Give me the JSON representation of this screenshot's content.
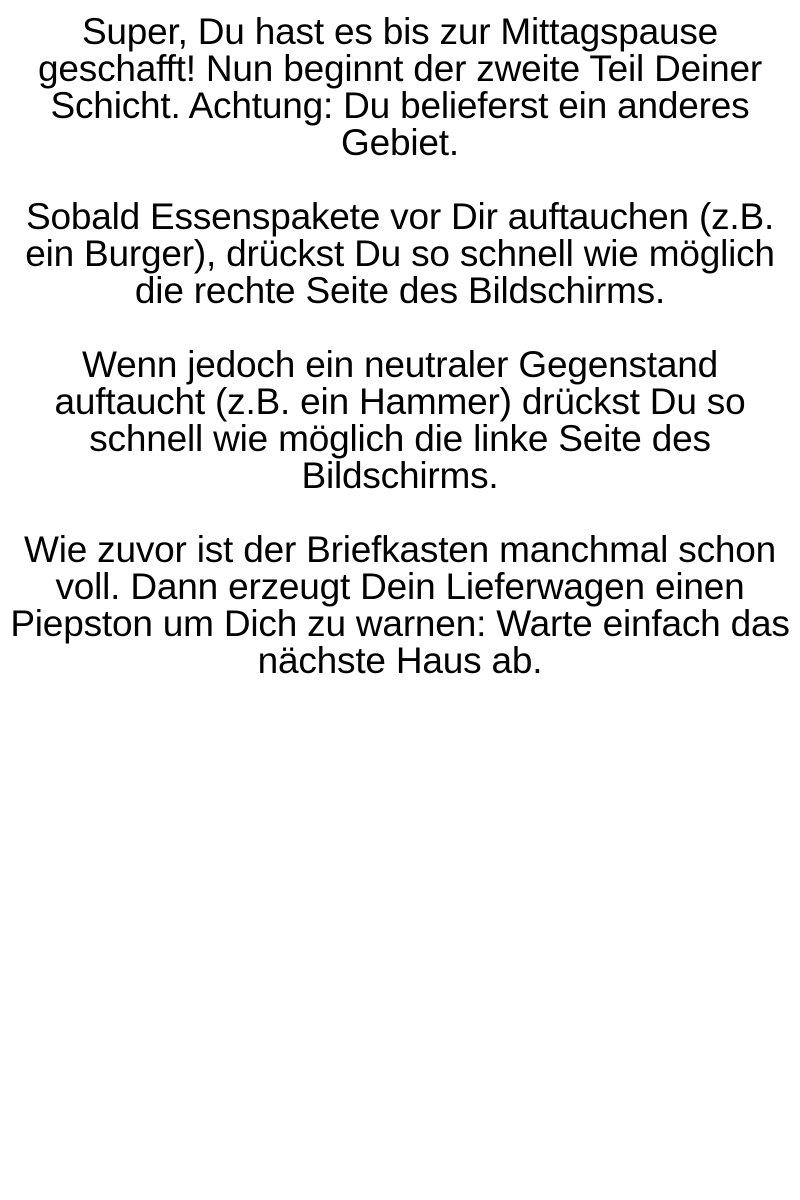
{
  "instructions": {
    "paragraphs": [
      "Super, Du hast es bis zur Mittagspause geschafft! Nun beginnt der zweite Teil Deiner Schicht. Achtung: Du belieferst ein anderes Gebiet.",
      "Sobald Essenspakete vor Dir auftauchen (z.B. ein Burger), drückst Du so schnell wie möglich die rechte Seite des Bildschirms.",
      "Wenn jedoch ein neutraler Gegenstand auftaucht (z.B. ein Hammer) drückst Du so schnell wie möglich die linke Seite des Bildschirms.",
      "Wie zuvor ist der Briefkasten manchmal schon voll. Dann erzeugt Dein Lieferwagen einen Piepston um Dich zu warnen: Warte einfach das nächste Haus ab."
    ]
  }
}
